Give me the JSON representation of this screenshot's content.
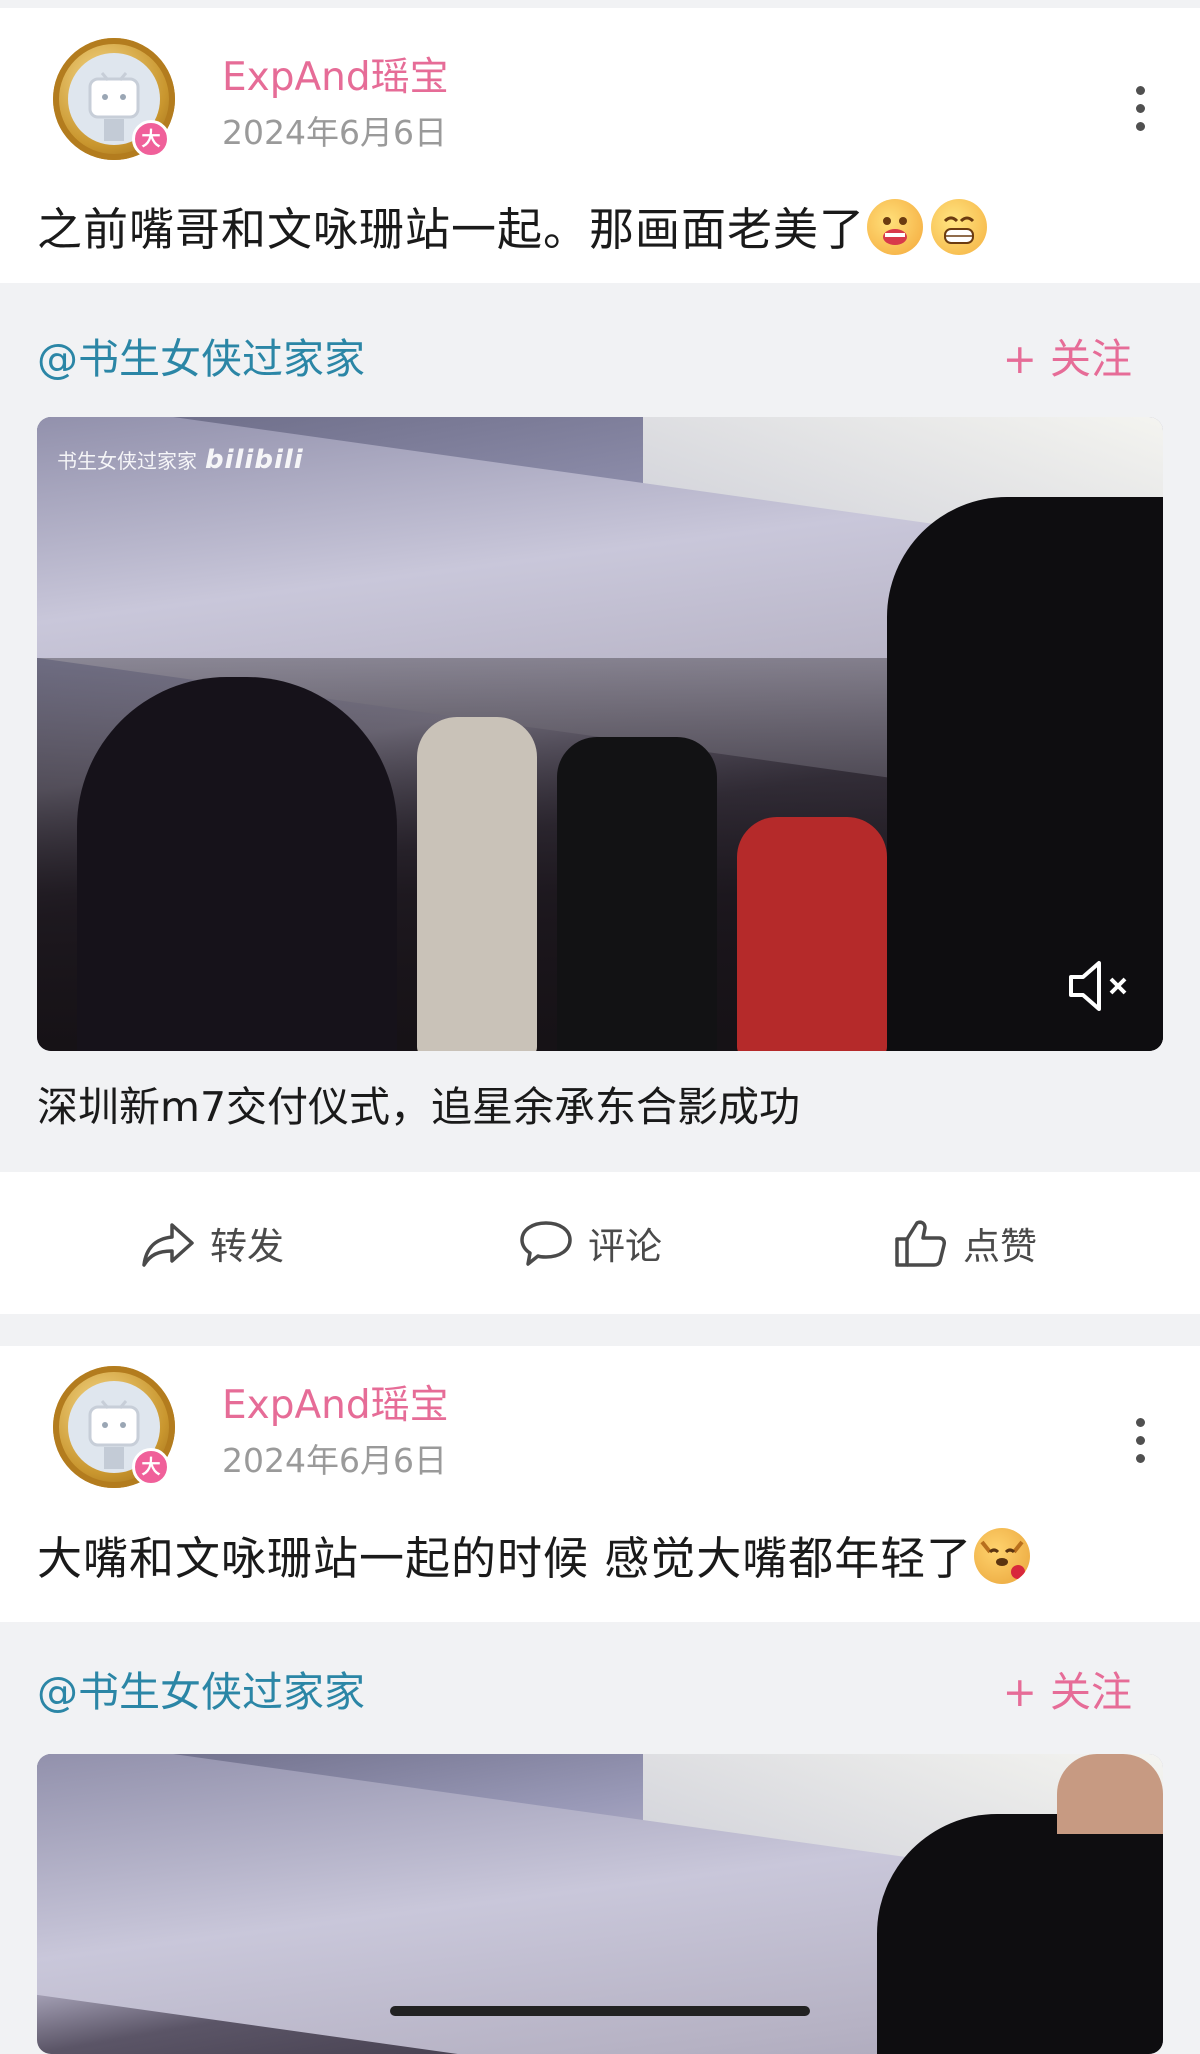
{
  "posts": [
    {
      "username": "ExpAnd瑶宝",
      "date": "2024年6月6日",
      "badge": "大",
      "caption": "之前嘴哥和文咏珊站一起。那画面老美了",
      "repost": {
        "mention": "@书生女侠过家家",
        "follow_label": "+ 关注",
        "watermark_text": "书生女侠过家家",
        "watermark_logo": "bilibili",
        "video_title": "深圳新m7交付仪式，追星余承东合影成功"
      },
      "actions": {
        "share": "转发",
        "comment": "评论",
        "like": "点赞"
      }
    },
    {
      "username": "ExpAnd瑶宝",
      "date": "2024年6月6日",
      "badge": "大",
      "caption": "大嘴和文咏珊站一起的时候 感觉大嘴都年轻了",
      "repost": {
        "mention": "@书生女侠过家家",
        "follow_label": "+ 关注"
      }
    }
  ],
  "icons": {
    "more": "more-vertical-icon",
    "share": "share-arrow-icon",
    "comment": "comment-bubble-icon",
    "like": "thumbs-up-icon",
    "mute": "speaker-muted-icon"
  },
  "colors": {
    "username": "#e66c97",
    "mention": "#2b86a6",
    "follow": "#e66c97",
    "background": "#f1f2f4"
  }
}
